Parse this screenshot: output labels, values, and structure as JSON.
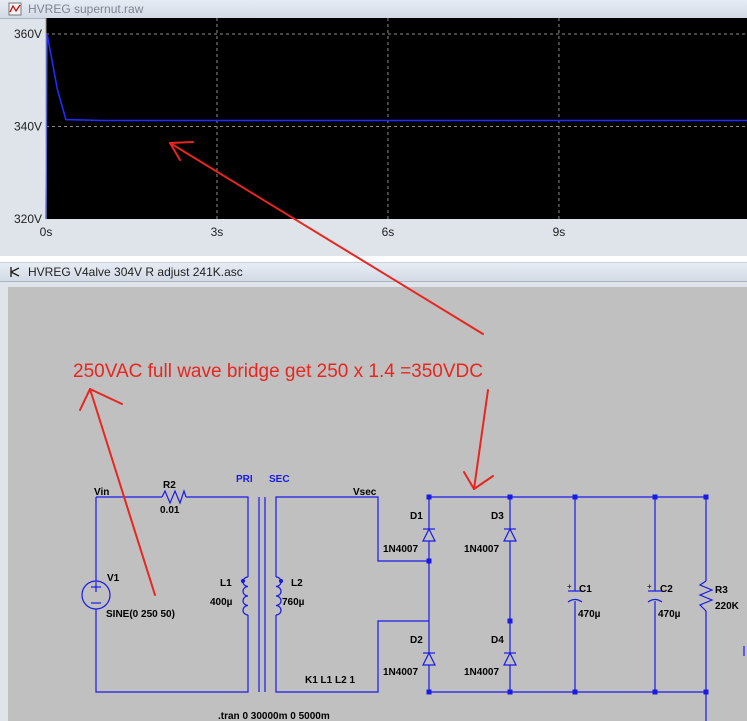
{
  "plot_window": {
    "title": "HVREG supernut.raw",
    "trace_color": "#1f2bff",
    "grid_color": "#8c8c8c",
    "background": "#000000",
    "y_ticks": [
      "360V",
      "340V",
      "320V"
    ],
    "x_ticks": [
      "0s",
      "3s",
      "6s",
      "9s"
    ]
  },
  "chart_data": {
    "type": "line",
    "title": "",
    "xlabel": "",
    "ylabel": "",
    "xlim": [
      0,
      12.3
    ],
    "ylim": [
      320,
      360
    ],
    "series": [
      {
        "name": "",
        "x": [
          0,
          0.02,
          0.2,
          0.35,
          1,
          3,
          6,
          9,
          12.3
        ],
        "y": [
          320,
          360,
          348,
          341.5,
          341.3,
          341.3,
          341.3,
          341.3,
          341.3
        ]
      }
    ]
  },
  "schematic_window": {
    "title": "HVREG V4alve 304V R adjust 241K.asc",
    "wire_color": "#1a1ae6",
    "labels": {
      "vin": "Vin",
      "r2": "R2",
      "r2_val": "0.01",
      "pri": "PRI",
      "sec": "SEC",
      "vsec": "Vsec",
      "v1": "V1",
      "v1_val": "SINE(0 250 50)",
      "l1": "L1",
      "l1_val": "400µ",
      "l2": "L2",
      "l2_val": "760µ",
      "k1": "K1 L1 L2 1",
      "d1": "D1",
      "d2": "D2",
      "d3": "D3",
      "d4": "D4",
      "d1_val": "1N4007",
      "d2_val": "1N4007",
      "d3_val": "1N4007",
      "d4_val": "1N4007",
      "c1": "C1",
      "c1_val": "470µ",
      "c2": "C2",
      "c2_val": "470µ",
      "r3": "R3",
      "r3_val": "220K",
      "tran": ".tran 0 30000m 0 5000m"
    }
  },
  "annotation": {
    "text": "250VAC full wave bridge get 250 x 1.4 =350VDC",
    "color": "#e8261f"
  }
}
